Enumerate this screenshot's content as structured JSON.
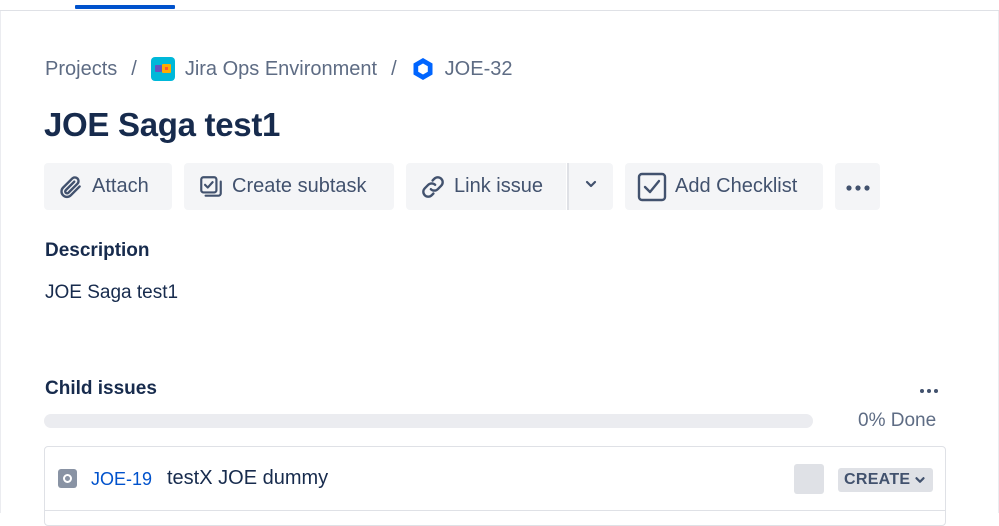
{
  "breadcrumb": {
    "projects": "Projects",
    "separator": "/",
    "project": "Jira Ops Environment",
    "issue_key": "JOE-32"
  },
  "issue": {
    "title": "JOE Saga test1"
  },
  "toolbar": {
    "attach": "Attach",
    "create_subtask": "Create subtask",
    "link_issue": "Link issue",
    "add_checklist": "Add Checklist"
  },
  "description": {
    "heading": "Description",
    "text": "JOE Saga test1"
  },
  "child_issues": {
    "heading": "Child issues",
    "progress_percent": 0,
    "progress_label": "0% Done",
    "items": [
      {
        "key": "JOE-19",
        "summary": "testX JOE dummy",
        "status": "CREATE"
      }
    ]
  },
  "colors": {
    "accent": "#0052cc",
    "text": "#172b4d",
    "muted": "#5e6c84",
    "button_bg": "#f4f5f7"
  },
  "icons": {
    "project": "project-avatar-icon",
    "issue_type": "saga-hexagon-icon",
    "attach": "paperclip-icon",
    "subtask": "subtask-icon",
    "link": "link-icon",
    "checklist": "checkbox-icon",
    "more": "ellipsis-icon",
    "child_type": "subtask-type-icon"
  }
}
